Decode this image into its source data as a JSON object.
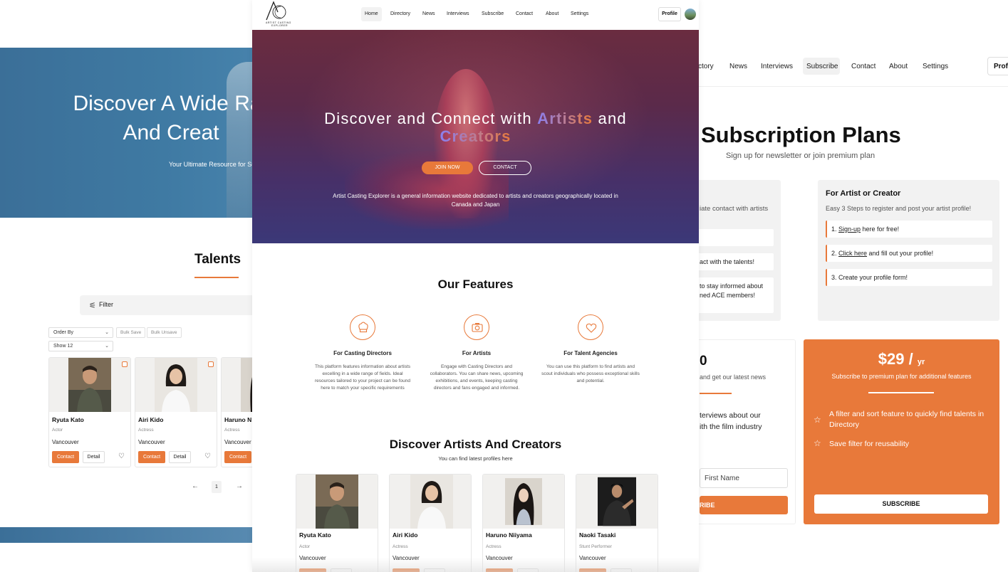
{
  "left": {
    "hero_title_line1": "Discover A Wide Rar",
    "hero_title_line2": "And Creat",
    "hero_subtitle": "Your Ultimate Resource for Suc",
    "talents_title": "Talents",
    "filter_label": "Filter",
    "order_by": "Order By",
    "bulk_save": "Bulk Save",
    "bulk_unsave": "Bulk Unsave",
    "show": "Show 12",
    "cards": [
      {
        "name": "Ryuta Kato",
        "role": "Actor",
        "city": "Vancouver"
      },
      {
        "name": "Airi Kido",
        "role": "Actress",
        "city": "Vancouver"
      },
      {
        "name": "Haruno N",
        "role": "Actress",
        "city": "Vancouver"
      }
    ],
    "contact_label": "Contact",
    "detail_label": "Detail",
    "page_number": "1"
  },
  "right": {
    "nav": {
      "directory": "ctory",
      "news": "News",
      "interviews": "Interviews",
      "subscribe": "Subscribe",
      "contact": "Contact",
      "about": "About",
      "settings": "Settings",
      "profile": "Profil"
    },
    "title": "Subscription Plans",
    "subtitle": "Sign up for newsletter or join premium plan",
    "box_left": {
      "text": "iate contact with artists",
      "row2": "act with the talents!",
      "row3_line1": "to stay informed about",
      "row3_line2": "ned ACE members!"
    },
    "box_right": {
      "title": "For Artist or Creator",
      "subtitle": "Easy 3 Steps to register and post your artist profile!",
      "step1_prefix": "1. ",
      "step1_link": "Sign-up",
      "step1_suffix": " here for free!",
      "step2_prefix": "2. ",
      "step2_link": "Click here",
      "step2_suffix": " and fill out your profile!",
      "step3": "3. Create your profile form!"
    },
    "plan_free": {
      "price": "0",
      "desc": "and get our latest news",
      "feature_line1": "terviews about our",
      "feature_line2": "ith the film industry",
      "input_placeholder": "First Name",
      "button": "RIBE"
    },
    "plan_premium": {
      "price": "$29",
      "per": "yr",
      "desc": "Subscribe to premium plan for additional features",
      "feature1": "A filter and sort feature to quickly find talents in Directory",
      "feature2": "Save filter for reusability",
      "button": "SUBSCRIBE"
    }
  },
  "main": {
    "logo_text_line1": "ARTIST CASTING",
    "logo_text_line2": "EXPLORER",
    "nav": {
      "home": "Home",
      "directory": "Directory",
      "news": "News",
      "interviews": "Interviews",
      "subscribe": "Subscribe",
      "contact": "Contact",
      "about": "About",
      "settings": "Settings",
      "profile": "Profile"
    },
    "hero": {
      "title_part1": "Discover and Connect with ",
      "title_highlight1": "Artists",
      "title_part2": " and",
      "title_highlight2": "Creators",
      "join_button": "JOIN NOW",
      "contact_button": "CONTACT",
      "description": "Artist Casting Explorer is a general information website dedicated to artists and creators geographically located in Canada and Japan"
    },
    "features_title": "Our Features",
    "features": [
      {
        "icon": "chef-hat-icon",
        "title": "For Casting Directors",
        "desc": "This platform features information about artists excelling in a wide range of fields. Ideal resources tailored to your project can be found here to match your specific requirements"
      },
      {
        "icon": "camera-icon",
        "title": "For Artists",
        "desc": "Engage with Casting Directors and collaborators. You can share news, upcoming exhibitions, and events, keeping casting directors and fans engaged and informed."
      },
      {
        "icon": "heart-icon",
        "title": "For Talent Agencies",
        "desc": "You can use this platform to find artists and scout individuals who possess exceptional skills and potential."
      }
    ],
    "discover_title": "Discover Artists And Creators",
    "discover_subtitle": "You can find latest profiles here",
    "cards": [
      {
        "name": "Ryuta Kato",
        "role": "Actor",
        "city": "Vancouver"
      },
      {
        "name": "Airi Kido",
        "role": "Actress",
        "city": "Vancouver"
      },
      {
        "name": "Haruno Niiyama",
        "role": "Actress",
        "city": "Vancouver"
      },
      {
        "name": "Naoki Tasaki",
        "role": "Stunt Performer",
        "city": "Vancouver"
      }
    ]
  },
  "colors": {
    "accent": "#e8793a",
    "hero_gradient_top": "#6a2c40",
    "hero_gradient_bottom": "#3b3878",
    "left_hero": "#3b6f98"
  }
}
